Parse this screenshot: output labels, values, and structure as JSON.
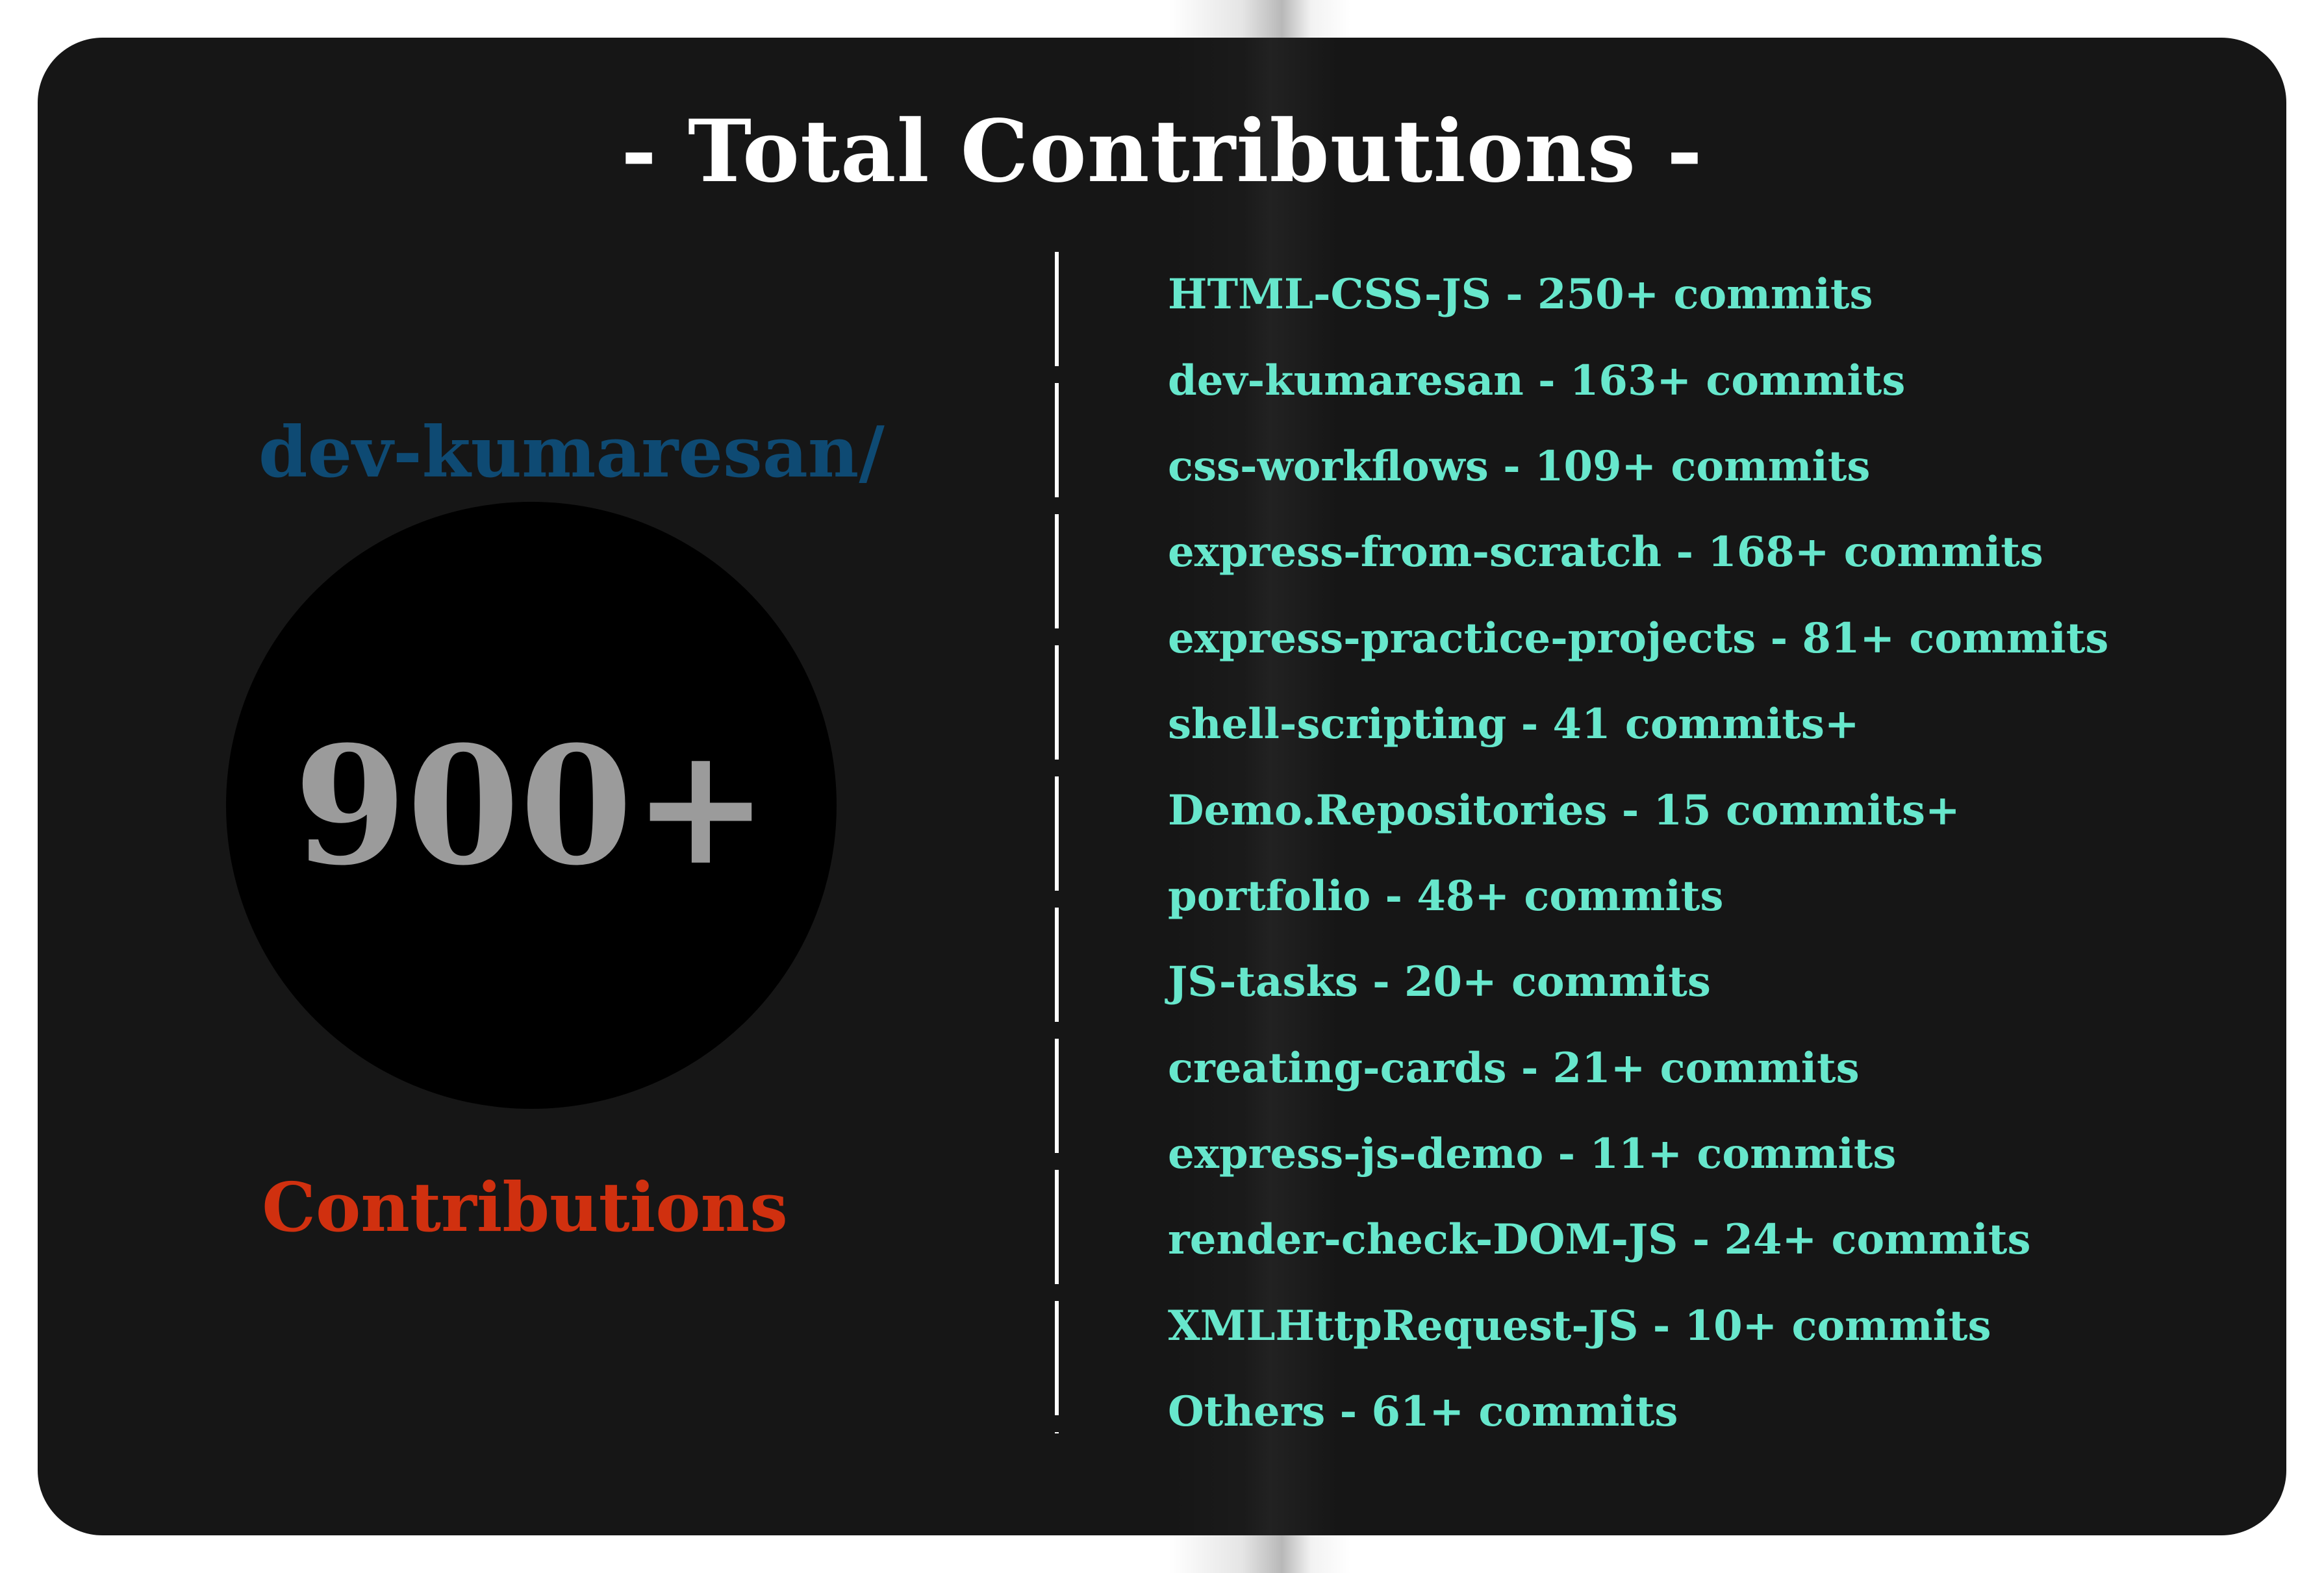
{
  "title": "- Total Contributions -",
  "profile": {
    "username": "dev-kumaresan/",
    "total": "900+",
    "total_label": "Contributions"
  },
  "colors": {
    "card_background": "#161616",
    "title": "#ffffff",
    "username": "#0e4a73",
    "total_value": "#9b9b9b",
    "contributions_label": "#d0300f",
    "repo_text": "#67e7cc"
  },
  "repositories": [
    "HTML-CSS-JS - 250+ commits",
    "dev-kumaresan - 163+ commits",
    "css-workflows - 109+ commits",
    "express-from-scratch - 168+ commits",
    "express-practice-projects - 81+ commits",
    "shell-scripting - 41 commits+",
    "Demo.Repositories - 15 commits+",
    "portfolio - 48+ commits",
    "JS-tasks - 20+ commits",
    "creating-cards - 21+ commits",
    "express-js-demo - 11+ commits",
    "render-check-DOM-JS - 24+ commits",
    "XMLHttpRequest-JS - 10+ commits",
    "Others - 61+ commits"
  ]
}
